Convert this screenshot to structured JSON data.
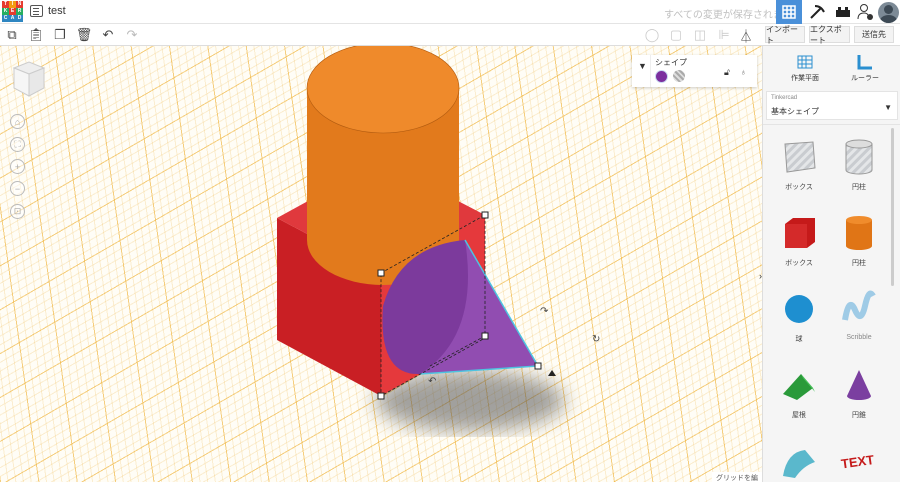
{
  "app": {
    "logo_letters": [
      "T",
      "I",
      "N",
      "K",
      "E",
      "R",
      "C",
      "A",
      "D"
    ],
    "title": "test",
    "save_status": "すべての変更が保存されました"
  },
  "topbar": {
    "icons": [
      "grid-view-icon",
      "pickaxe-icon",
      "bricks-icon",
      "add-user-icon",
      "avatar"
    ]
  },
  "toolbar": {
    "import_label": "インポート",
    "export_label": "エクスポート",
    "send_label": "送信先"
  },
  "shape_panel": {
    "title": "シェイプ",
    "solid_color": "#7b2f9e"
  },
  "right_panel": {
    "workplane_label": "作業平面",
    "ruler_label": "ルーラー",
    "library_source": "Tinkercad",
    "library_name": "基本シェイプ",
    "shapes": [
      {
        "label": "ボックス"
      },
      {
        "label": "円柱"
      },
      {
        "label": "ボックス"
      },
      {
        "label": "円柱"
      },
      {
        "label": "球"
      },
      {
        "label": "Scribble"
      },
      {
        "label": "屋根"
      },
      {
        "label": "円錐"
      },
      {
        "label": ""
      },
      {
        "label": ""
      }
    ]
  },
  "viewport": {
    "edit_grid_label": "グリッドを編集"
  },
  "colors": {
    "accent": "#4a90d9",
    "box": "#d42a2a",
    "cylinder": "#e67e22",
    "cone": "#7b3fa0"
  }
}
